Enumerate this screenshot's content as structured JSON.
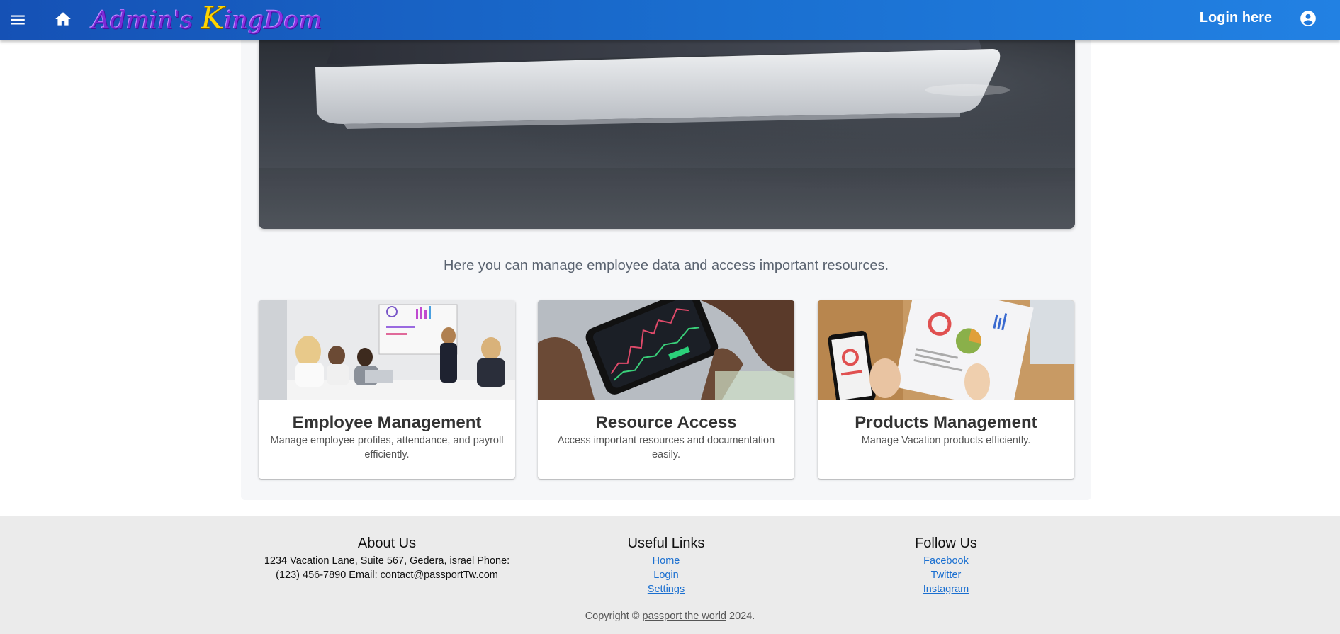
{
  "header": {
    "logo": {
      "part1": "Admin's ",
      "part2": "K",
      "part3": "ingDom"
    },
    "login_label": "Login here",
    "icons": {
      "menu": "menu-icon",
      "home": "home-icon",
      "account": "account-circle-icon"
    }
  },
  "main": {
    "hero_image": "laptop-photo",
    "intro": "Here you can manage employee data and access important resources.",
    "cards": [
      {
        "title": "Employee Management",
        "description": "Manage employee profiles, attendance, and payroll efficiently.",
        "image": "team-meeting-photo"
      },
      {
        "title": "Resource Access",
        "description": "Access important resources and documentation easily.",
        "image": "phone-trading-photo"
      },
      {
        "title": "Products Management",
        "description": "Manage Vacation products efficiently.",
        "image": "charts-report-photo"
      }
    ]
  },
  "footer": {
    "about": {
      "heading": "About Us",
      "text": "1234 Vacation Lane, Suite 567, Gedera, israel Phone: (123) 456-7890 Email: contact@passportTw.com"
    },
    "links": {
      "heading": "Useful Links",
      "items": [
        "Home",
        "Login",
        "Settings"
      ]
    },
    "follow": {
      "heading": "Follow Us",
      "items": [
        "Facebook",
        "Twitter",
        "Instagram"
      ]
    },
    "copyright": {
      "prefix": "Copyright © ",
      "link": "passport the world",
      "suffix": " 2024."
    }
  },
  "colors": {
    "appbar_start": "#1551b5",
    "appbar_end": "#2281e3",
    "link": "#1a6fd0",
    "footer_bg": "#ebebeb"
  }
}
